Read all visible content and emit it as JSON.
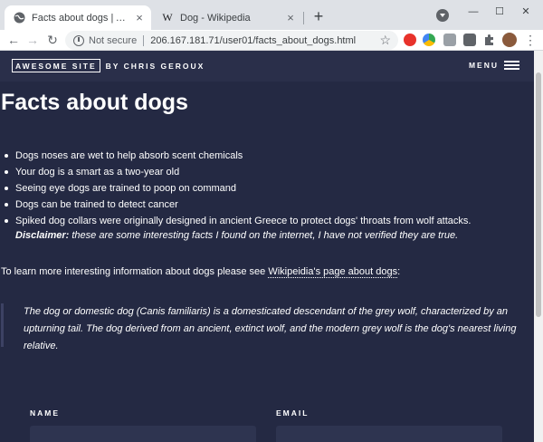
{
  "browser": {
    "tabs": [
      {
        "title": "Facts about dogs | Awesome Site",
        "close_glyph": "×",
        "active": true
      },
      {
        "title": "Dog - Wikipedia",
        "favicon_text": "W",
        "close_glyph": "×",
        "active": false
      }
    ],
    "new_tab_glyph": "+",
    "window_controls": {
      "minimize": "—",
      "maximize": "☐",
      "close": "✕"
    },
    "nav": {
      "back": "←",
      "forward": "→",
      "reload": "↻",
      "kebab": "⋮"
    },
    "address": {
      "security_label": "Not secure",
      "url": "206.167.181.71/user01/facts_about_dogs.html",
      "star": "☆"
    }
  },
  "site": {
    "logo_text": "AWESOME SITE",
    "byline": "BY CHRIS GEROUX",
    "menu_label": "MENU"
  },
  "content": {
    "title": "Facts about dogs",
    "facts": [
      "Dogs noses are wet to help absorb scent chemicals",
      "Your dog is a smart as a two-year old",
      "Seeing eye dogs are trained to poop on command",
      "Dogs can be trained to detect cancer",
      "Spiked dog collars were originally designed in ancient Greece to protect dogs' throats from wolf attacks."
    ],
    "disclaimer_label": "Disclaimer:",
    "disclaimer_text": " these are some interesting facts I found on the internet, I have not verified they are true.",
    "learn_prefix": "To learn more interesting information about dogs please see ",
    "learn_link": "Wikipeidia's page about dogs",
    "learn_suffix": ":",
    "quote": "The dog or domestic dog (Canis familiaris) is a domesticated descendant of the grey wolf, characterized by an upturning tail. The dog derived from an ancient, extinct wolf, and the modern grey wolf is the dog's nearest living relative."
  },
  "form": {
    "name_label": "NAME",
    "email_label": "EMAIL"
  },
  "colors": {
    "page_bg": "#242943",
    "header_bg": "#2a2f4a",
    "text": "#ffffff"
  }
}
